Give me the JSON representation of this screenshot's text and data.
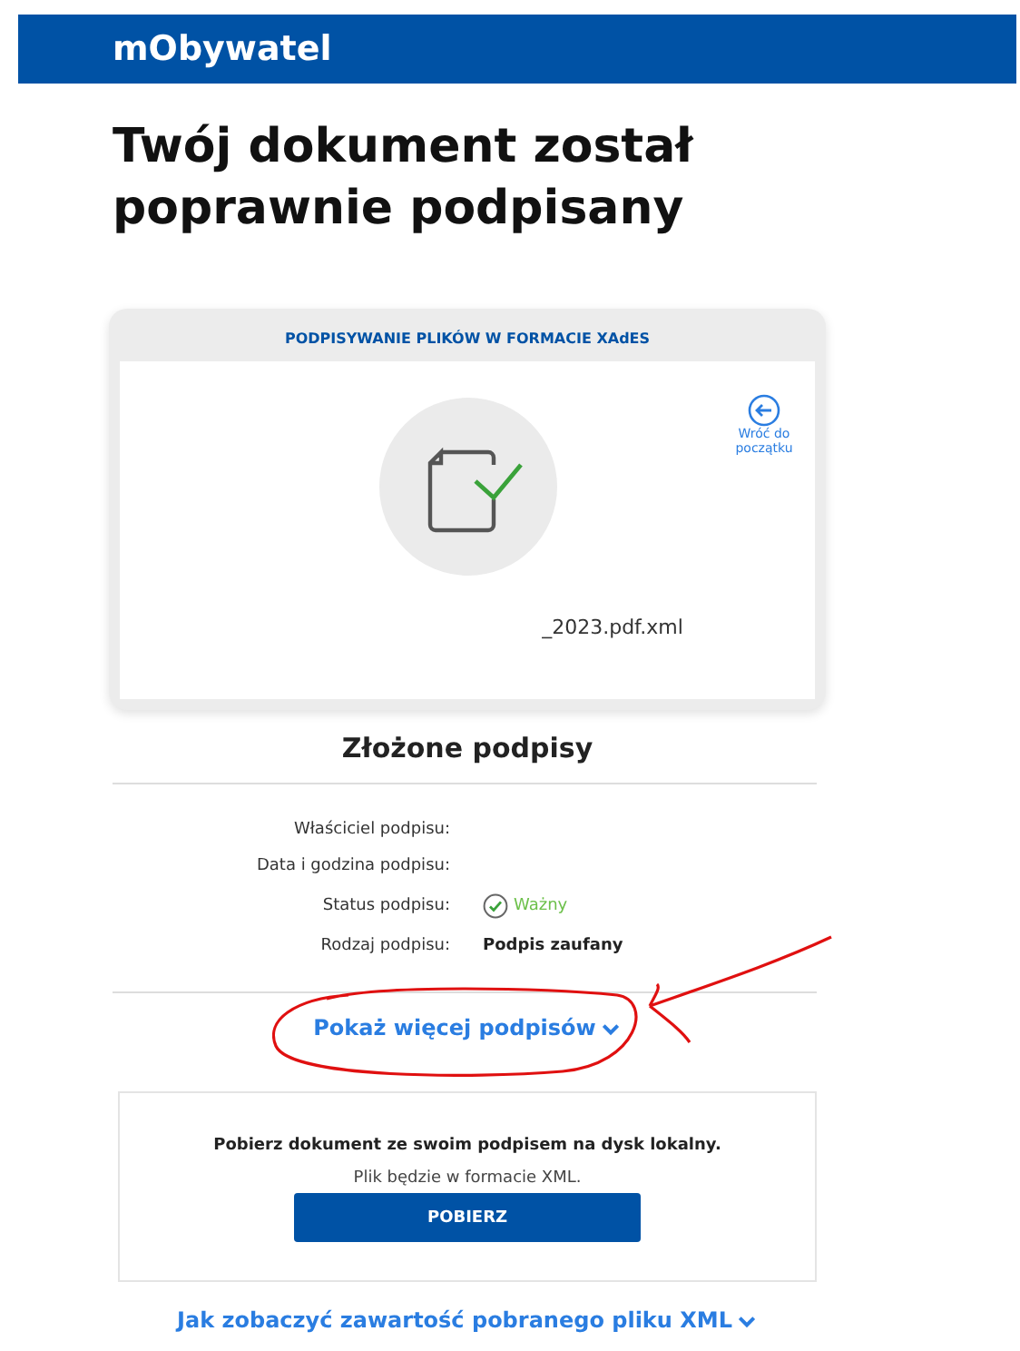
{
  "header": {
    "title": "mObywatel"
  },
  "heading": "Twój dokument został poprawnie podpisany",
  "card": {
    "title": "PODPISYWANIE PLIKÓW W FORMACIE XAdES",
    "back_link": "Wróć do początku",
    "file_name": "_2023.pdf.xml"
  },
  "signatures": {
    "title": "Złożone podpisy",
    "rows": [
      {
        "label": "Właściciel podpisu:",
        "kind": "blank"
      },
      {
        "label": "Data i godzina podpisu:",
        "kind": "blank"
      },
      {
        "label": "Status podpisu:",
        "kind": "status",
        "value": "Ważny"
      },
      {
        "label": "Rodzaj podpisu:",
        "kind": "text",
        "value": "Podpis zaufany"
      }
    ],
    "more_link": "Pokaż więcej podpisów",
    "expanded": false
  },
  "download": {
    "text": "Pobierz dokument ze swoim podpisem na dysk lokalny.",
    "note": "Plik będzie w formacie XML.",
    "button": "POBIERZ"
  },
  "help_link": "Jak zobaczyć zawartość pobranego pliku XML"
}
